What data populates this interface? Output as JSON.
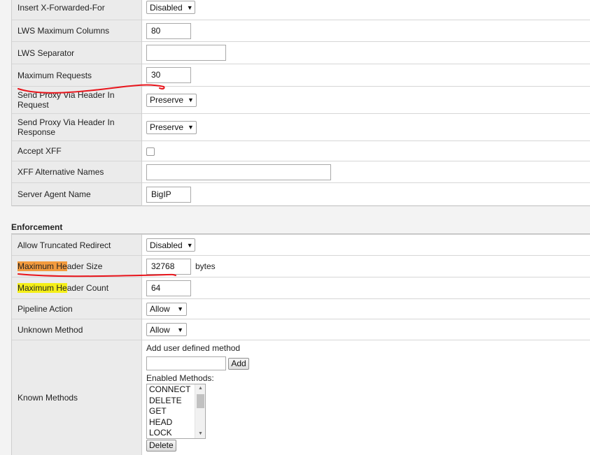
{
  "top_rows": [
    {
      "label": "Insert X-Forwarded-For",
      "type": "select",
      "value": "Disabled"
    },
    {
      "label": "LWS Maximum Columns",
      "type": "input",
      "value": "80"
    },
    {
      "label": "LWS Separator",
      "type": "input",
      "value": ""
    },
    {
      "label": "Maximum Requests",
      "type": "input",
      "value": "30"
    },
    {
      "label": "Send Proxy Via Header In Request",
      "type": "select",
      "value": "Preserve"
    },
    {
      "label": "Send Proxy Via Header In Response",
      "type": "select",
      "value": "Preserve"
    },
    {
      "label": "Accept XFF",
      "type": "checkbox",
      "value": ""
    },
    {
      "label": "XFF Alternative Names",
      "type": "input",
      "value": ""
    },
    {
      "label": "Server Agent Name",
      "type": "input",
      "value": "BigIP"
    }
  ],
  "enforcement": {
    "title": "Enforcement",
    "allow_truncated_redirect": {
      "label": "Allow Truncated Redirect",
      "value": "Disabled"
    },
    "max_header_size": {
      "label_hl": "Maximum He",
      "label_rest": "ader Size",
      "value": "32768",
      "unit": "bytes"
    },
    "max_header_count": {
      "label_hl": "Maximum He",
      "label_rest": "ader Count",
      "value": "64"
    },
    "pipeline_action": {
      "label": "Pipeline Action",
      "value": "Allow"
    },
    "unknown_method": {
      "label": "Unknown Method",
      "value": "Allow"
    },
    "known_methods": {
      "label": "Known Methods",
      "add_label": "Add user defined method",
      "add_button": "Add",
      "enabled_label": "Enabled Methods:",
      "methods": [
        "CONNECT",
        "DELETE",
        "GET",
        "HEAD",
        "LOCK"
      ],
      "delete_button": "Delete"
    }
  },
  "colors": {
    "highlight_orange": "#f39b3e",
    "highlight_yellow": "#f5ef18",
    "annotation_red": "#e8141b"
  }
}
